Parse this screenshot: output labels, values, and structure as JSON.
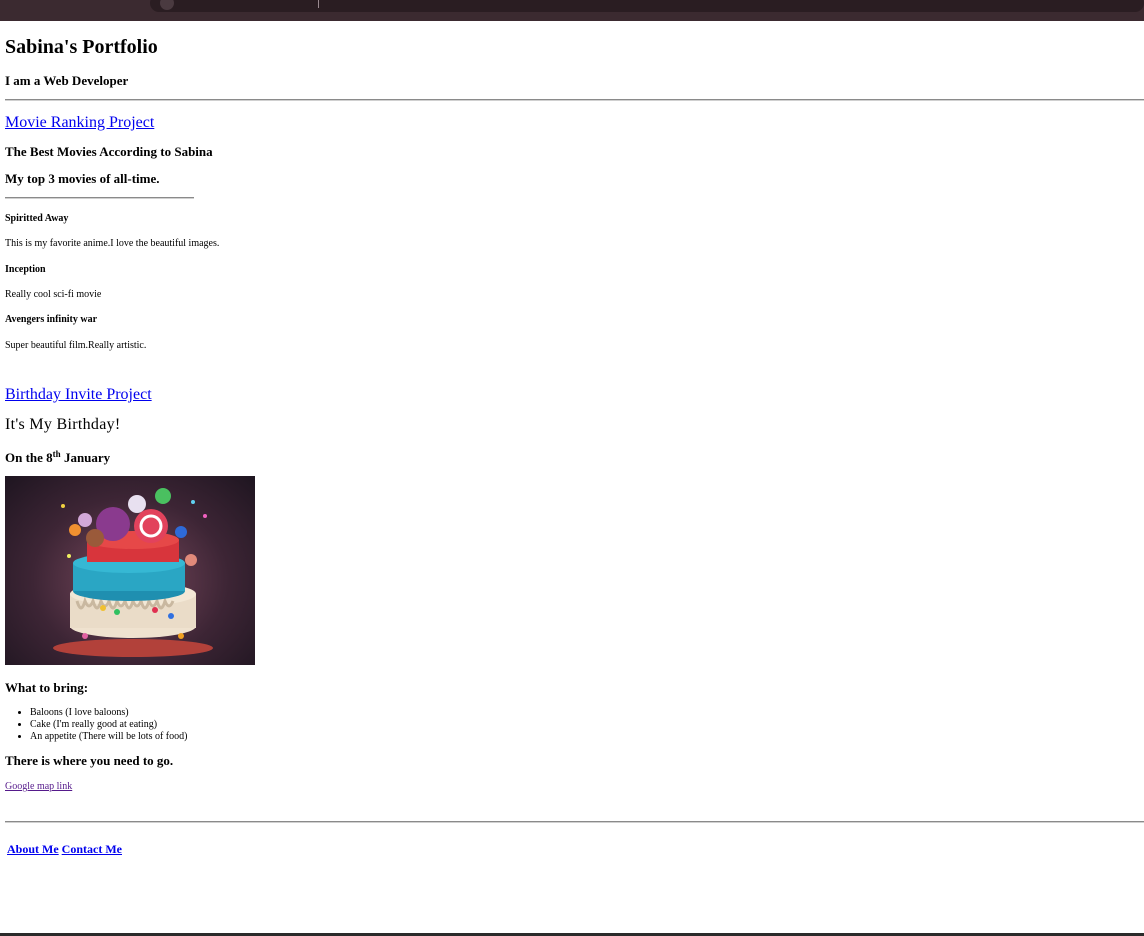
{
  "header": {
    "title": "Sabina's Portfolio",
    "subtitle": "I am a Web Developer"
  },
  "movie_project": {
    "link": "Movie Ranking Project",
    "heading": "The Best Movies According to Sabina",
    "subheading": "My top 3 movies of all-time.",
    "movies": [
      {
        "title": "Spiritted Away",
        "description": "This is my favorite anime.I love the beautiful images."
      },
      {
        "title": "Inception",
        "description": "Really cool sci-fi movie"
      },
      {
        "title": "Avengers infinity war",
        "description": "Super beautiful film.Really artistic."
      }
    ]
  },
  "birthday_project": {
    "link": "Birthday Invite Project",
    "heading": "It's My Birthday!",
    "date_prefix": "On the 8",
    "date_sup": "th",
    "date_suffix": " January",
    "bring_heading": "What to bring:",
    "bring_items": [
      "Baloons (I love baloons)",
      "Cake (I'm really good at eating)",
      "An appetite (There will be lots of food)"
    ],
    "where_heading": "There is where you need to go.",
    "map_link": "Google map link"
  },
  "footer": {
    "about": "About Me",
    "contact": "Contact Me"
  },
  "colors": {
    "link": "#0000ee",
    "visited_link": "#551a8b",
    "browser_bar": "#3b2a30"
  }
}
